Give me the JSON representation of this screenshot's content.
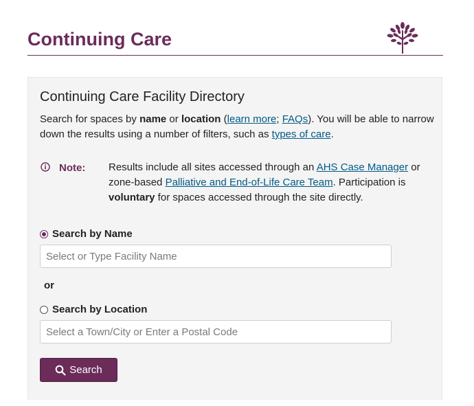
{
  "header": {
    "title": "Continuing Care",
    "logo": "tree-logo-icon"
  },
  "panel": {
    "title": "Continuing Care Facility Directory",
    "intro": {
      "t1": "Search for spaces by ",
      "name": "name",
      "t2": " or ",
      "location": "location",
      "t3": " (",
      "learn_more": "learn more",
      "t4": "; ",
      "faqs": "FAQs",
      "t5": "). You will be able to narrow down the results using a number of filters, such as ",
      "types_of_care": "types of care",
      "t6": "."
    },
    "note": {
      "icon": "info-circle-icon",
      "label": "Note:",
      "t1": "Results include all sites accessed through an ",
      "case_manager": "AHS Case Manager",
      "t2": " or zone-based ",
      "palliative": "Palliative and End-of-Life Care Team",
      "t3": ". Participation is ",
      "voluntary": "voluntary",
      "t4": " for spaces accessed through the site directly."
    },
    "search_by_name": {
      "label": "Search by Name",
      "selected": true,
      "placeholder": "Select or Type Facility Name",
      "value": ""
    },
    "or_text": "or",
    "search_by_location": {
      "label": "Search by Location",
      "selected": false,
      "placeholder": "Select a Town/City or Enter a Postal Code",
      "value": ""
    },
    "search_button": {
      "label": "Search",
      "icon": "search-icon"
    }
  },
  "colors": {
    "brand": "#6b2c5a",
    "link": "#005a87",
    "panel_bg": "#f4f4f4"
  }
}
